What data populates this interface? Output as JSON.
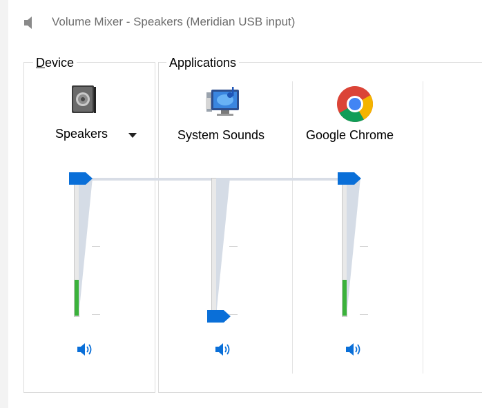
{
  "window": {
    "title": "Volume Mixer - Speakers (Meridian USB input)"
  },
  "device": {
    "group_label_mnemonic": "D",
    "group_label_rest": "evice",
    "label": "Speakers",
    "icon": "speaker-device-icon",
    "volume_percent": 100,
    "peak_percent": 26
  },
  "applications": {
    "group_label": "Applications",
    "items": [
      {
        "label": "System Sounds",
        "icon": "system-sounds-icon",
        "volume_percent": 0,
        "peak_percent": 0
      },
      {
        "label": "Google Chrome",
        "icon": "chrome-icon",
        "volume_percent": 100,
        "peak_percent": 26
      }
    ]
  },
  "colors": {
    "accent": "#0a6fd8",
    "meter": "#3bb23b",
    "title_text": "#6d6d6d"
  }
}
